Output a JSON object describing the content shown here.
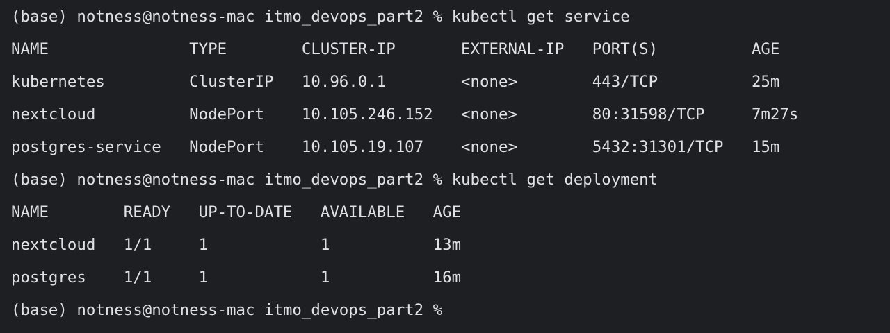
{
  "terminal": {
    "lines": [
      "(base) notness@notness-mac itmo_devops_part2 % kubectl get service",
      "NAME               TYPE        CLUSTER-IP       EXTERNAL-IP   PORT(S)          AGE",
      "kubernetes         ClusterIP   10.96.0.1        <none>        443/TCP          25m",
      "nextcloud          NodePort    10.105.246.152   <none>        80:31598/TCP     7m27s",
      "postgres-service   NodePort    10.105.19.107    <none>        5432:31301/TCP   15m",
      "(base) notness@notness-mac itmo_devops_part2 % kubectl get deployment",
      "NAME        READY   UP-TO-DATE   AVAILABLE   AGE",
      "nextcloud   1/1     1            1           13m",
      "postgres    1/1     1            1           16m",
      "(base) notness@notness-mac itmo_devops_part2 % "
    ]
  }
}
